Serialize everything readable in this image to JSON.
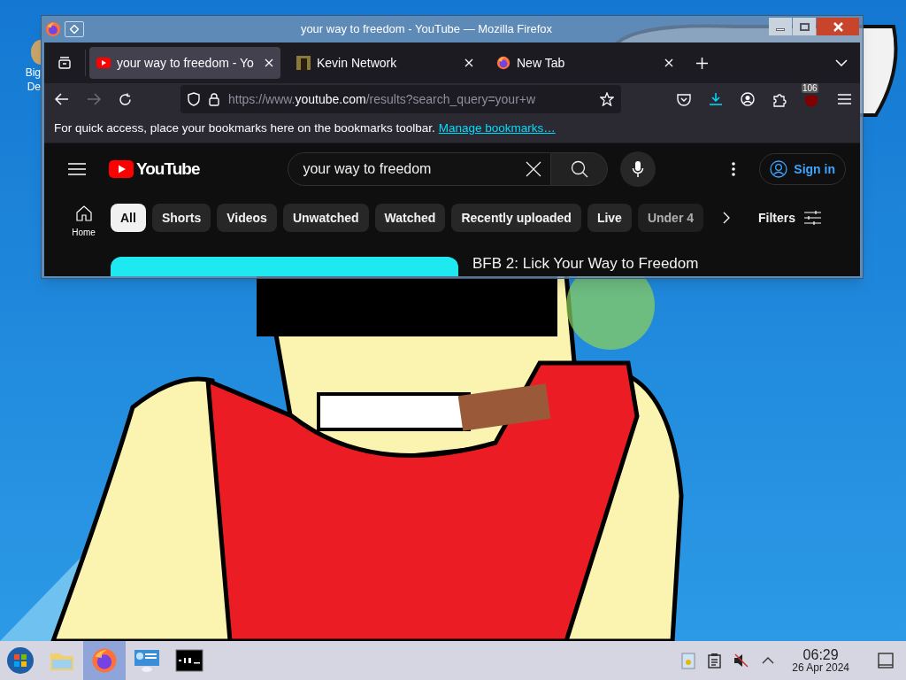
{
  "desktop_icon": {
    "label_lines": [
      "Big",
      "De"
    ]
  },
  "window": {
    "title": "your way to freedom - YouTube — Mozilla Firefox"
  },
  "tabs": [
    {
      "title": "your way to freedom - Yo",
      "selected": true,
      "kind": "youtube"
    },
    {
      "title": "Kevin Network",
      "selected": false,
      "kind": "image"
    },
    {
      "title": "New Tab",
      "selected": false,
      "kind": "firefox"
    }
  ],
  "address_bar": {
    "url_prefix": "https://www.",
    "url_host": "youtube.com",
    "url_rest": "/results?search_query=your+w"
  },
  "navigation": {
    "forward_disabled": true,
    "extension_badge": "106"
  },
  "bookmarks_bar": {
    "message": "For quick access, place your bookmarks here on the bookmarks toolbar.",
    "link": "Manage bookmarks…"
  },
  "youtube": {
    "logo": "YouTube",
    "search_value": "your way to freedom",
    "sign_in": "Sign in",
    "sidebar": [
      {
        "label": "Home"
      }
    ],
    "chips": [
      {
        "label": "All",
        "selected": true
      },
      {
        "label": "Shorts",
        "selected": false
      },
      {
        "label": "Videos",
        "selected": false
      },
      {
        "label": "Unwatched",
        "selected": false
      },
      {
        "label": "Watched",
        "selected": false
      },
      {
        "label": "Recently uploaded",
        "selected": false
      },
      {
        "label": "Live",
        "selected": false
      },
      {
        "label": "Under 4",
        "selected": false
      }
    ],
    "filters": "Filters",
    "results": [
      {
        "title": "BFB 2: Lick Your Way to Freedom"
      }
    ]
  },
  "taskbar": {
    "apps": [
      {
        "kind": "files",
        "active": false
      },
      {
        "kind": "firefox",
        "active": true
      },
      {
        "kind": "remote",
        "active": false
      },
      {
        "kind": "terminal",
        "active": false
      }
    ],
    "volume_muted": true,
    "time": "06:29",
    "date": "26 Apr 2024"
  }
}
